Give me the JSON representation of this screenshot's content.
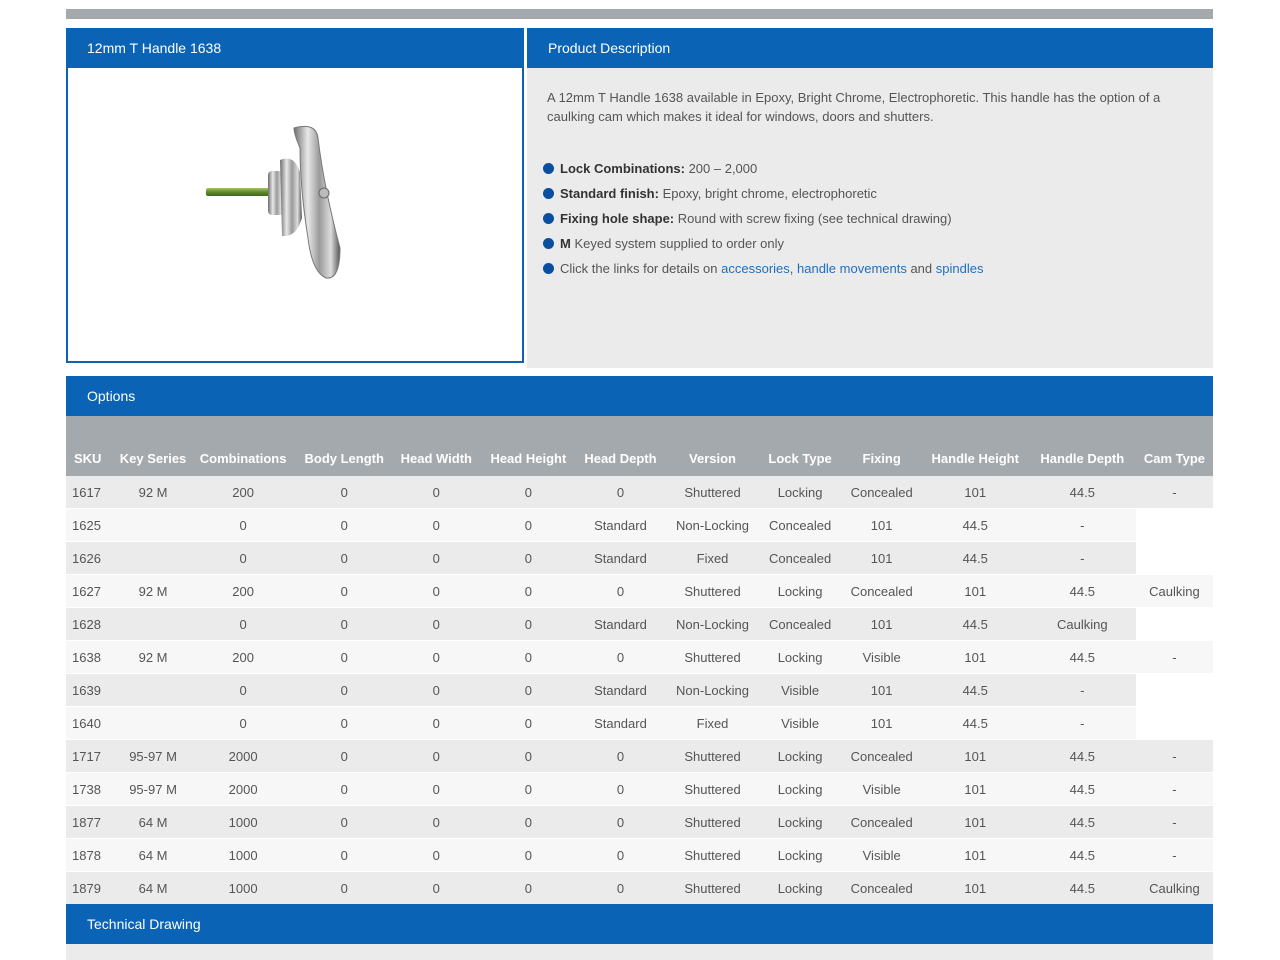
{
  "product": {
    "title": "12mm T Handle 1638"
  },
  "description": {
    "header": "Product Description",
    "text": "A 12mm T Handle 1638 available in Epoxy, Bright Chrome, Electrophoretic. This handle has the option of a caulking cam which makes it ideal for windows, doors and shutters.",
    "bullets": [
      {
        "label": "Lock Combinations:",
        "text": " 200 – 2,000"
      },
      {
        "label": "Standard finish:",
        "text": " Epoxy, bright chrome, electrophoretic"
      },
      {
        "label": "Fixing hole shape:",
        "text": " Round with screw fixing (see technical drawing)"
      },
      {
        "label": "M",
        "text": " Keyed system supplied to order only"
      }
    ],
    "links_line": {
      "prefix": "Click the links for details on ",
      "link1": "accessories",
      "sep1": ", ",
      "link2": "handle movements",
      "sep2": " and ",
      "link3": "spindles"
    },
    "bullet_color": "#0a4ea0",
    "link_color": "#1d6fc4"
  },
  "options": {
    "header": "Options",
    "columns": [
      "SKU",
      "Key Series",
      "Combinations",
      "Body Length",
      "Head Width",
      "Head Height",
      "Head Depth",
      "Version",
      "Lock Type",
      "Fixing",
      "Handle Height",
      "Handle Depth",
      "Cam Type"
    ],
    "rows": [
      [
        "1617",
        "92 M",
        "200",
        "0",
        "0",
        "0",
        "0",
        "Shuttered",
        "Locking",
        "Concealed",
        "101",
        "44.5",
        "-"
      ],
      [
        "1625",
        "",
        "0",
        "0",
        "0",
        "0",
        "Standard",
        "Non-Locking",
        "Concealed",
        "101",
        "44.5",
        "-",
        null
      ],
      [
        "1626",
        "",
        "0",
        "0",
        "0",
        "0",
        "Standard",
        "Fixed",
        "Concealed",
        "101",
        "44.5",
        "-",
        null
      ],
      [
        "1627",
        "92 M",
        "200",
        "0",
        "0",
        "0",
        "0",
        "Shuttered",
        "Locking",
        "Concealed",
        "101",
        "44.5",
        "Caulking"
      ],
      [
        "1628",
        "",
        "0",
        "0",
        "0",
        "0",
        "Standard",
        "Non-Locking",
        "Concealed",
        "101",
        "44.5",
        "Caulking",
        null
      ],
      [
        "1638",
        "92 M",
        "200",
        "0",
        "0",
        "0",
        "0",
        "Shuttered",
        "Locking",
        "Visible",
        "101",
        "44.5",
        "-"
      ],
      [
        "1639",
        "",
        "0",
        "0",
        "0",
        "0",
        "Standard",
        "Non-Locking",
        "Visible",
        "101",
        "44.5",
        "-",
        null
      ],
      [
        "1640",
        "",
        "0",
        "0",
        "0",
        "0",
        "Standard",
        "Fixed",
        "Visible",
        "101",
        "44.5",
        "-",
        null
      ],
      [
        "1717",
        "95-97 M",
        "2000",
        "0",
        "0",
        "0",
        "0",
        "Shuttered",
        "Locking",
        "Concealed",
        "101",
        "44.5",
        "-"
      ],
      [
        "1738",
        "95-97 M",
        "2000",
        "0",
        "0",
        "0",
        "0",
        "Shuttered",
        "Locking",
        "Visible",
        "101",
        "44.5",
        "-"
      ],
      [
        "1877",
        "64 M",
        "1000",
        "0",
        "0",
        "0",
        "0",
        "Shuttered",
        "Locking",
        "Concealed",
        "101",
        "44.5",
        "-"
      ],
      [
        "1878",
        "64 M",
        "1000",
        "0",
        "0",
        "0",
        "0",
        "Shuttered",
        "Locking",
        "Visible",
        "101",
        "44.5",
        "-"
      ],
      [
        "1879",
        "64 M",
        "1000",
        "0",
        "0",
        "0",
        "0",
        "Shuttered",
        "Locking",
        "Concealed",
        "101",
        "44.5",
        "Caulking"
      ]
    ]
  },
  "technical_drawing": {
    "header": "Technical Drawing"
  },
  "colors": {
    "header_blue": "#0a63b4",
    "table_header_grey": "#a4a9ad",
    "panel_grey": "#ebebeb"
  }
}
